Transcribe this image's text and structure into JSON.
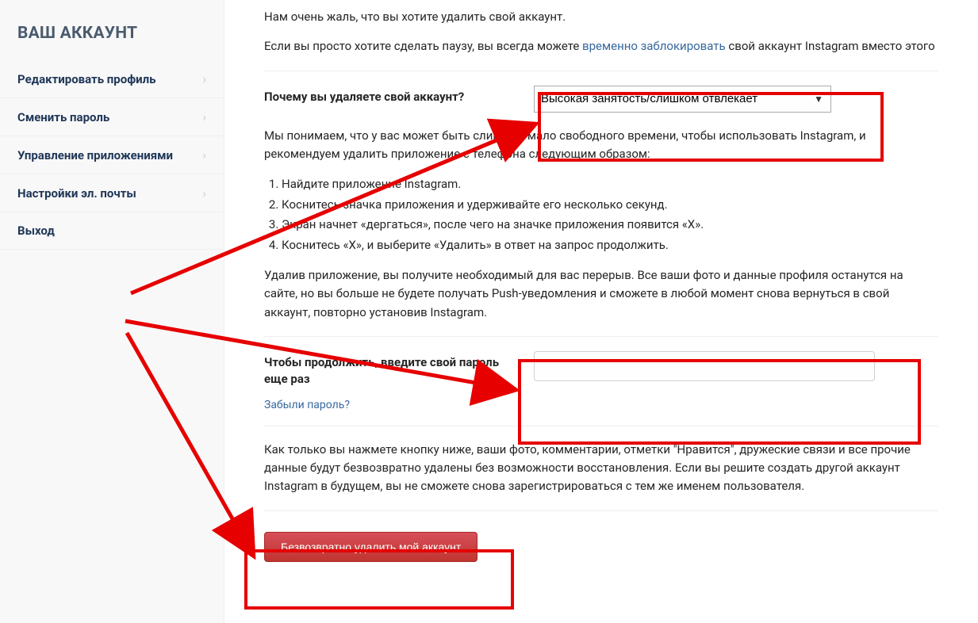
{
  "sidebar": {
    "title": "ВАШ АККАУНТ",
    "items": [
      {
        "label": "Редактировать профиль"
      },
      {
        "label": "Сменить пароль"
      },
      {
        "label": "Управление приложениями"
      },
      {
        "label": "Настройки эл. почты"
      },
      {
        "label": "Выход"
      }
    ]
  },
  "main": {
    "sorry_text": "Нам очень жаль, что вы хотите удалить свой аккаунт.",
    "pause_prefix": "Если вы просто хотите сделать паузу, вы всегда можете ",
    "pause_link": "временно заблокировать",
    "pause_suffix": " свой аккаунт Instagram вместо этого",
    "reason_label": "Почему вы удаляете свой аккаунт?",
    "reason_selected": "Высокая занятость/слишком отвлекает",
    "explain_text": "Мы понимаем, что у вас может быть слишком мало свободного времени, чтобы использовать Instagram, и рекомендуем удалить приложение с телефона следующим образом:",
    "steps": [
      "Найдите приложение Instagram.",
      "Коснитесь значка приложения и удерживайте его несколько секунд.",
      "Экран начнет «дергаться», после чего на значке приложения появится «X».",
      "Коснитесь «X», и выберите «Удалить» в ответ на запрос продолжить."
    ],
    "after_text": "Удалив приложение, вы получите необходимый для вас перерыв. Все ваши фото и данные профиля останутся на сайте, но вы больше не будете получать Push-уведомления и сможете в любой момент снова вернуться в свой аккаунт, повторно установив Instagram.",
    "password_label": "Чтобы продолжить, введите свой пароль еще раз",
    "password_value": "",
    "forgot_label": "Забыли пароль?",
    "final_text": "Как только вы нажмете кнопку ниже, ваши фото, комментарии, отметки \"Нравится\", дружеские связи и все прочие данные будут безвозвратно удалены без возможности восстановления. Если вы решите создать другой аккаунт Instagram в будущем, вы не сможете снова зарегистрироваться с тем же именем пользователя.",
    "delete_button": "Безвозвратно удалить мой аккаунт"
  }
}
